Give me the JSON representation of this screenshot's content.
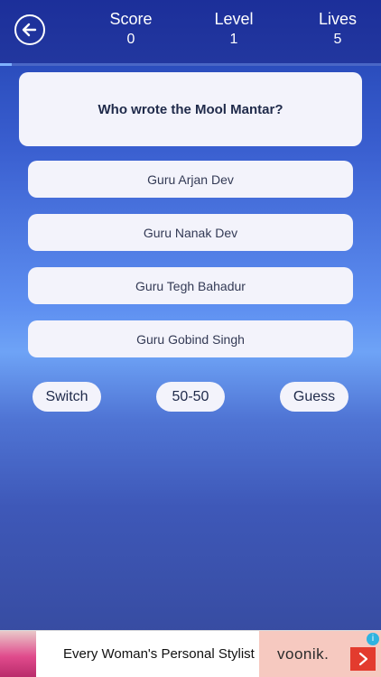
{
  "header": {
    "stats": [
      {
        "label": "Score",
        "value": "0"
      },
      {
        "label": "Level",
        "value": "1"
      },
      {
        "label": "Lives",
        "value": "5"
      }
    ],
    "progress": 0.03
  },
  "question": "Who wrote the Mool Mantar?",
  "options": [
    "Guru Arjan Dev",
    "Guru Nanak Dev",
    "Guru Tegh Bahadur",
    "Guru Gobind Singh"
  ],
  "lifelines": {
    "switch": "Switch",
    "fifty": "50-50",
    "guess": "Guess"
  },
  "ad": {
    "text": "Every Woman's Personal Stylist",
    "brand": "voonik.",
    "info": "i"
  },
  "icons": {
    "back": "back-arrow-icon",
    "ad_arrow": "chevron-right-icon"
  },
  "colors": {
    "ad_cta": "#e33b2e",
    "ad_brand_bg": "#f6c9c0"
  }
}
